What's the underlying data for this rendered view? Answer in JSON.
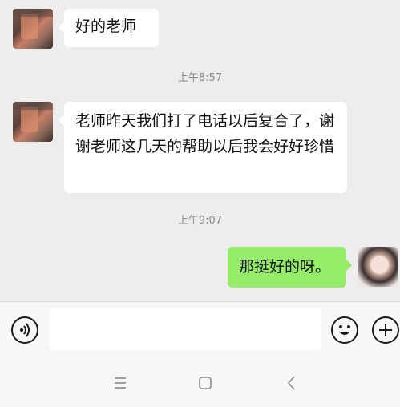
{
  "messages": [
    {
      "side": "incoming",
      "text": "好的老师"
    },
    {
      "side": "incoming",
      "text": "老师昨天我们打了电话以后复合了，谢谢老师这几天的帮助以后我会好好珍惜"
    },
    {
      "side": "outgoing",
      "text": "那挺好的呀。"
    }
  ],
  "timestamps": [
    "上午8:57",
    "上午9:07"
  ],
  "input_bar": {
    "voice_icon": "voice-icon",
    "message_value": "",
    "emoji_icon": "emoji-icon",
    "plus_icon": "plus-icon"
  },
  "nav_bar": {
    "icons": [
      "menu-icon",
      "home-icon",
      "back-icon"
    ]
  },
  "colors": {
    "chat_background": "#ededed",
    "incoming_bubble": "#ffffff",
    "outgoing_bubble": "#95ec69",
    "timestamp_text": "#8a8a8a"
  }
}
